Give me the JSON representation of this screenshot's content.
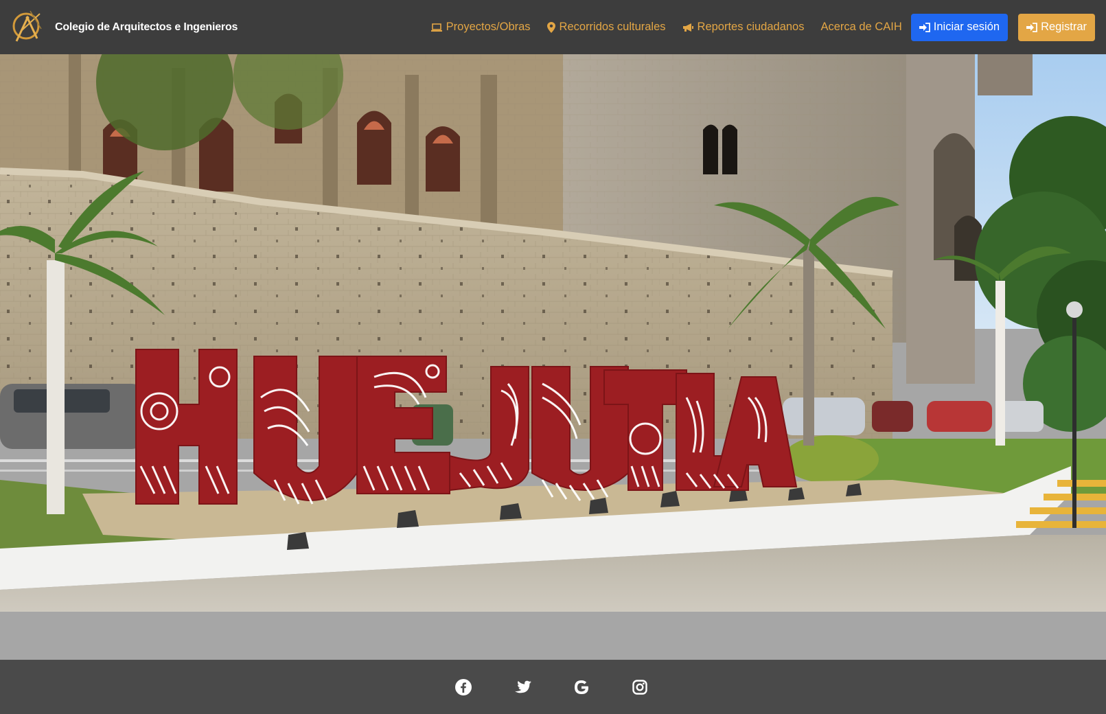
{
  "navbar": {
    "brand_name": "Colegio de Arquitectos e Ingenieros",
    "links": [
      {
        "label": "Proyectos/Obras",
        "icon": "laptop-icon"
      },
      {
        "label": "Recorridos culturales",
        "icon": "map-marker-icon"
      },
      {
        "label": "Reportes ciudadanos",
        "icon": "megaphone-icon"
      },
      {
        "label": "Acerca de CAIH",
        "icon": ""
      }
    ],
    "login_label": "Iniciar sesión",
    "register_label": "Registrar"
  },
  "hero": {
    "sign_text": "HUEJUTLA"
  },
  "footer": {
    "social": [
      "facebook-icon",
      "twitter-icon",
      "google-icon",
      "instagram-icon"
    ]
  },
  "colors": {
    "navbar_bg": "#3d3d3d",
    "accent": "#e3a645",
    "login_button": "#1f67f0",
    "band": "#a6a6a6",
    "footer_bg": "#4a4a4a"
  }
}
